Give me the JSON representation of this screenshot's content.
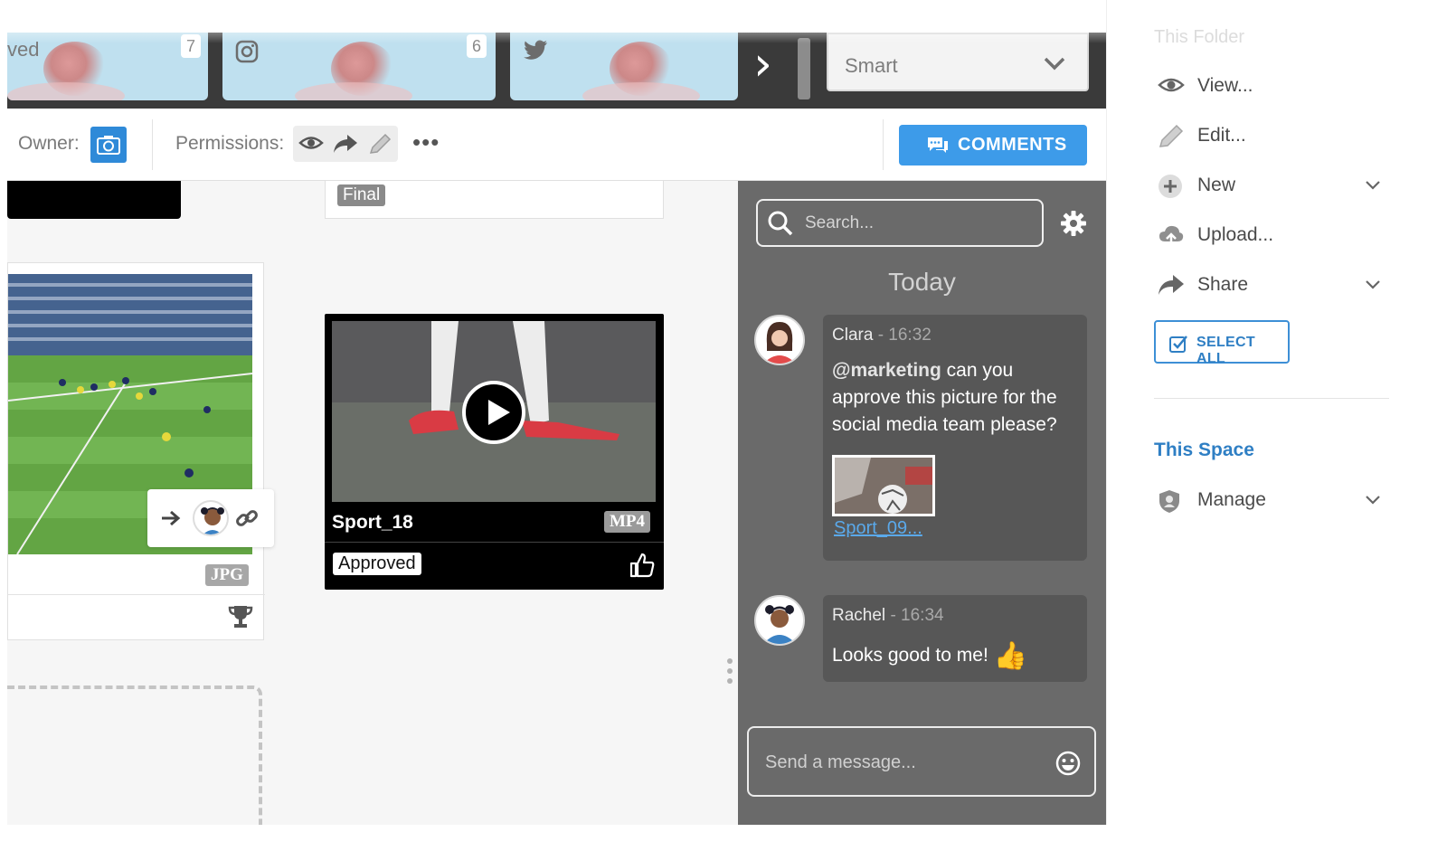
{
  "top_strip": {
    "tiles": [
      {
        "label": "ved",
        "count": "7"
      },
      {
        "icon": "instagram-icon",
        "count": "6"
      },
      {
        "icon": "twitter-icon"
      }
    ],
    "next_icon": "chevron-right-icon",
    "view_select": {
      "value": "Smart",
      "icon": "chevron-down-icon"
    }
  },
  "toolbar": {
    "owner_label": "Owner:",
    "permissions_label": "Permissions:",
    "more_label": "•••",
    "comments_label": "COMMENTS"
  },
  "cards": {
    "final_badge": "Final",
    "image_card": {
      "ext": "JPG",
      "icons": [
        "arrow-right-icon",
        "avatar",
        "link-icon",
        "trophy-icon"
      ]
    },
    "video_card": {
      "title": "Sport_18",
      "ext": "MP4",
      "status": "Approved",
      "icon": "thumbs-up-icon"
    }
  },
  "comments": {
    "search_placeholder": "Search...",
    "day_label": "Today",
    "messages": [
      {
        "author": "Clara",
        "time": "- 16:32",
        "mention": "@marketing",
        "text": " can you approve this picture for the social media team please?",
        "attachment": "Sport_09..."
      },
      {
        "author": "Rachel",
        "time": "- 16:34",
        "text": "Looks good to me!",
        "emoji": "👍"
      }
    ],
    "input_placeholder": "Send a message..."
  },
  "sidebar": {
    "folder_heading": "This Folder",
    "items": [
      {
        "label": "View...",
        "icon": "eye-icon"
      },
      {
        "label": "Edit...",
        "icon": "pencil-icon"
      },
      {
        "label": "New",
        "icon": "plus-circle-icon"
      },
      {
        "label": "Upload...",
        "icon": "cloud-upload-icon"
      },
      {
        "label": "Share",
        "icon": "share-arrow-icon"
      }
    ],
    "select_all_label": "SELECT ALL",
    "space_heading": "This Space",
    "space_items": [
      {
        "label": "Manage",
        "icon": "shield-icon"
      }
    ]
  },
  "colors": {
    "accent": "#3d9be9",
    "panel": "#6a6a6a",
    "link": "#2f7fc4"
  }
}
